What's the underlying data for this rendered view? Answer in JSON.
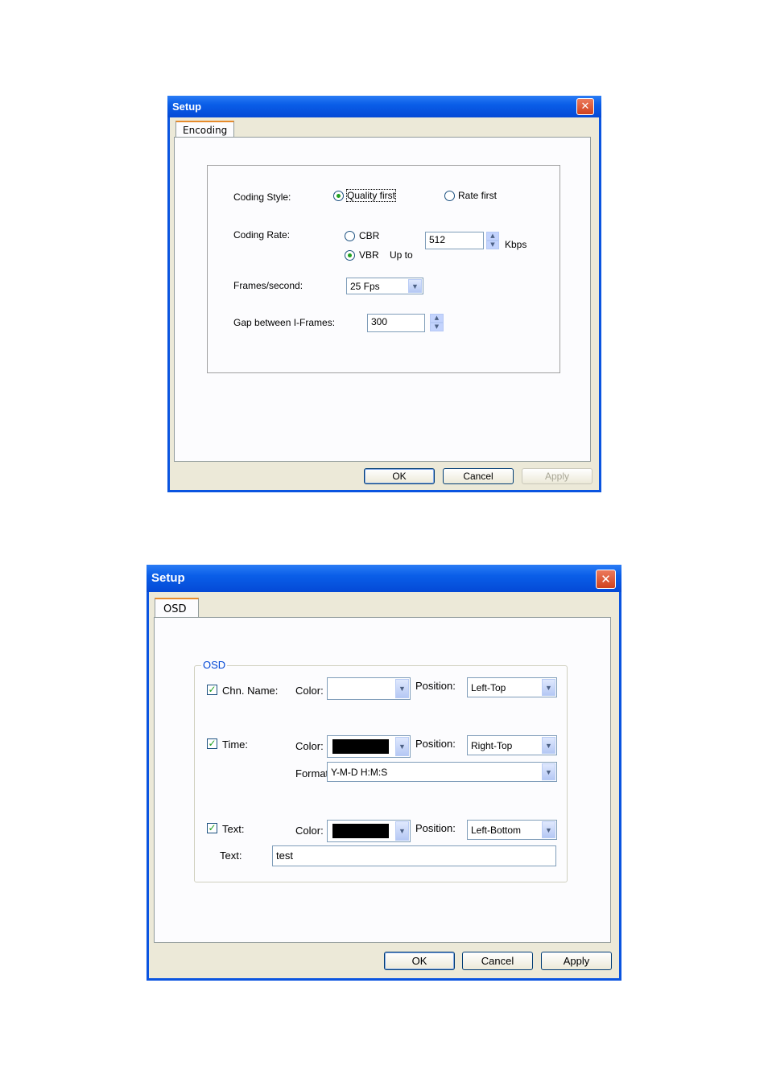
{
  "dialog1": {
    "title": "Setup",
    "close_glyph": "✕",
    "tab": "Encoding",
    "coding_style_label": "Coding Style:",
    "quality_first": "Quality first",
    "rate_first": "Rate first",
    "coding_rate_label": "Coding Rate:",
    "cbr": "CBR",
    "vbr": "VBR",
    "up_to": "Up to",
    "rate_value": "512",
    "kbps": "Kbps",
    "fps_label": "Frames/second:",
    "fps_value": "25  Fps",
    "gap_label": "Gap between I-Frames:",
    "gap_value": "300",
    "ok": "OK",
    "cancel": "Cancel",
    "apply": "Apply"
  },
  "dialog2": {
    "title": "Setup",
    "close_glyph": "✕",
    "tab": "OSD",
    "group_title": "OSD",
    "chn_name": "Chn. Name:",
    "time": "Time:",
    "text_check": "Text:",
    "color_label": "Color:",
    "position_label": "Position:",
    "format_label": "Format",
    "chn_position": "Left-Top",
    "time_position": "Right-Top",
    "time_format": "Y-M-D H:M:S",
    "text_position": "Left-Bottom",
    "text_label": "Text:",
    "text_value": "test",
    "ok": "OK",
    "cancel": "Cancel",
    "apply": "Apply"
  },
  "icons": {
    "check": "✓",
    "down_arrow": "▼",
    "up_arrow": "▲"
  },
  "colors": {
    "titlebar": "#0a5ee8",
    "client": "#ece9d8",
    "tab_accent": "#e68b2c",
    "group_title": "#0046d5"
  }
}
